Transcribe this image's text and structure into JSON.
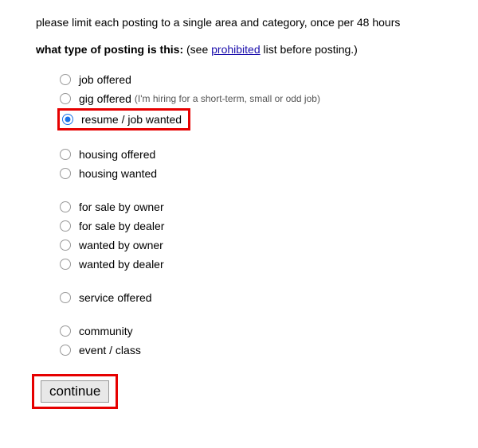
{
  "intro": "please limit each posting to a single area and category, once per 48 hours",
  "question": {
    "prefix_bold": "what type of posting is this:",
    "mid_text": " (see ",
    "link_text": "prohibited",
    "suffix_text": " list before posting.)"
  },
  "groups": [
    {
      "options": [
        {
          "label": "job offered",
          "sublabel": "",
          "selected": false
        },
        {
          "label": "gig offered",
          "sublabel": "(I'm hiring for a short-term, small or odd job)",
          "selected": false
        },
        {
          "label": "resume / job wanted",
          "sublabel": "",
          "selected": true
        }
      ]
    },
    {
      "options": [
        {
          "label": "housing offered",
          "sublabel": "",
          "selected": false
        },
        {
          "label": "housing wanted",
          "sublabel": "",
          "selected": false
        }
      ]
    },
    {
      "options": [
        {
          "label": "for sale by owner",
          "sublabel": "",
          "selected": false
        },
        {
          "label": "for sale by dealer",
          "sublabel": "",
          "selected": false
        },
        {
          "label": "wanted by owner",
          "sublabel": "",
          "selected": false
        },
        {
          "label": "wanted by dealer",
          "sublabel": "",
          "selected": false
        }
      ]
    },
    {
      "options": [
        {
          "label": "service offered",
          "sublabel": "",
          "selected": false
        }
      ]
    },
    {
      "options": [
        {
          "label": "community",
          "sublabel": "",
          "selected": false
        },
        {
          "label": "event / class",
          "sublabel": "",
          "selected": false
        }
      ]
    }
  ],
  "continue_label": "continue"
}
